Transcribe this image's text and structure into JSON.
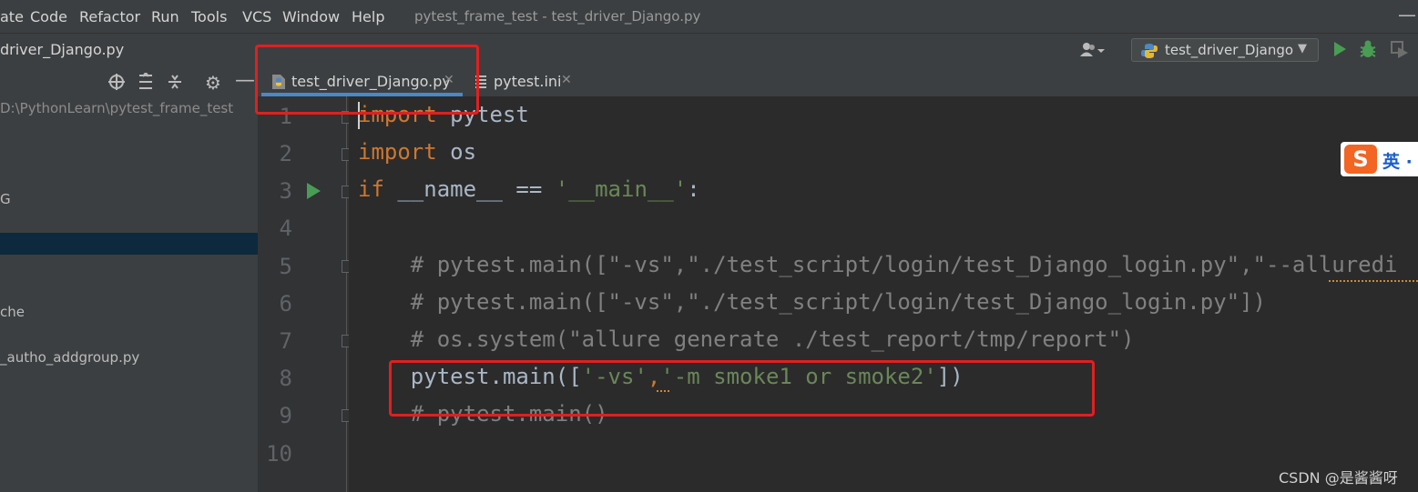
{
  "menubar": {
    "items": [
      "ate",
      "Code",
      "Refactor",
      "Run",
      "Tools",
      "VCS",
      "Window",
      "Help"
    ],
    "window_title": "pytest_frame_test - test_driver_Django.py"
  },
  "navbar": {
    "breadcrumb": "driver_Django.py",
    "run_config": "test_driver_Django"
  },
  "project_panel": {
    "rows": [
      "D:\\PythonLearn\\pytest_frame_test",
      "G",
      "che",
      "_autho_addgroup.py"
    ]
  },
  "tabs": [
    {
      "label": "test_driver_Django.py",
      "active": true,
      "icon": "python-file-icon"
    },
    {
      "label": "pytest.ini",
      "active": false,
      "icon": "ini-file-icon"
    }
  ],
  "editor": {
    "line_numbers": [
      "1",
      "2",
      "3",
      "4",
      "5",
      "6",
      "7",
      "8",
      "9",
      "10"
    ],
    "lines": {
      "l1_kw": "import",
      "l1_rest": " pytest",
      "l2_kw": "import",
      "l2_rest": " os",
      "l3_kw": "if",
      "l3_mid": " __name__ == ",
      "l3_str": "'__main__'",
      "l3_end": ":",
      "l5": "    # pytest.main([\"-vs\",\"./test_script/login/test_Django_login.py\",\"--alluredi",
      "l6": "    # pytest.main([\"-vs\",\"./test_script/login/test_Django_login.py\"])",
      "l7": "    # os.system(\"allure generate ./test_report/tmp/report\")",
      "l8_a": "    pytest.main([",
      "l8_s1": "'-vs'",
      "l8_comma": ",",
      "l8_s2": "'-m smoke1 or smoke2'",
      "l8_end": "])",
      "l9": "    # pytest.main()"
    }
  },
  "ime": {
    "logo": "S",
    "text": "英 ·"
  },
  "watermark": "CSDN @是酱酱呀",
  "colors": {
    "keyword": "#cc7832",
    "string": "#6a8759",
    "comment": "#808080",
    "highlight_box": "#e02020"
  }
}
